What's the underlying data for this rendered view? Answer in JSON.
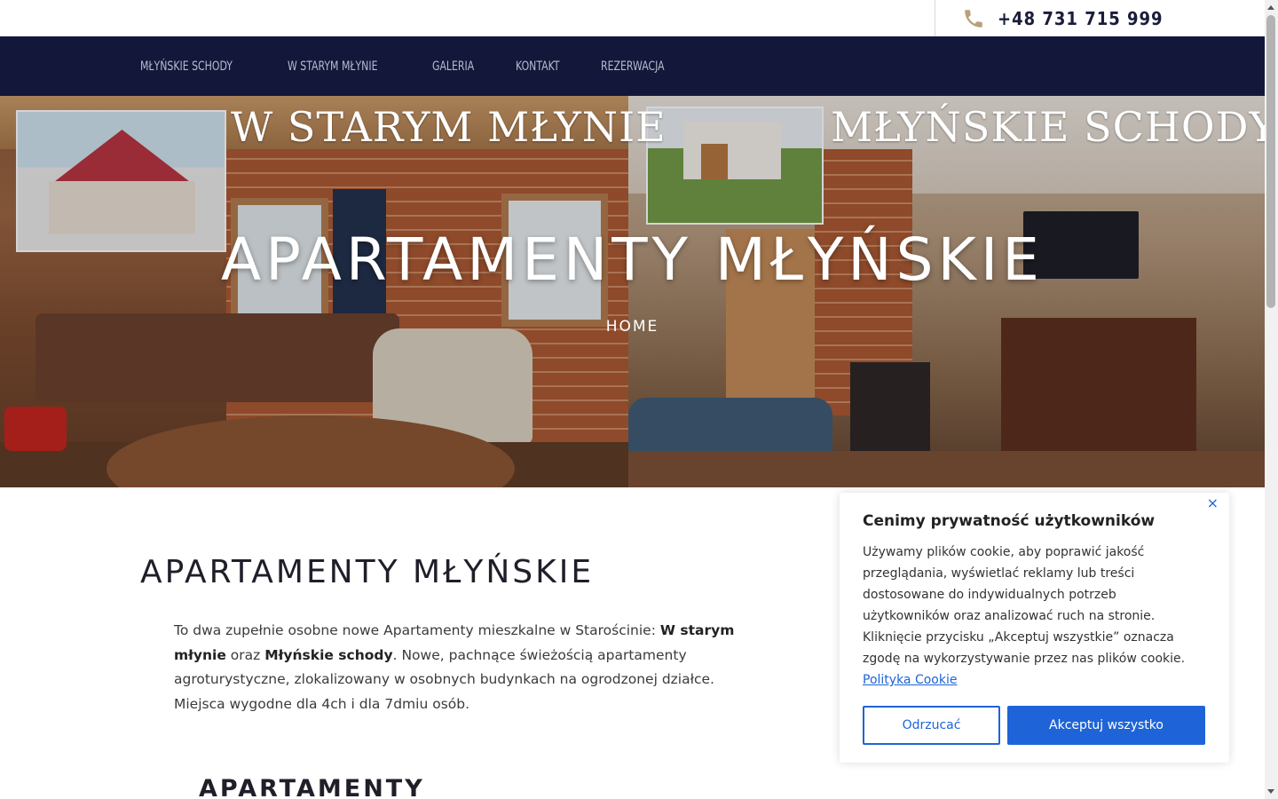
{
  "header": {
    "phone": "+48 731 715 999"
  },
  "nav": {
    "items": [
      {
        "label": "MŁYŃSKIE SCHODY"
      },
      {
        "label": "W STARYM MŁYNIE"
      },
      {
        "label": "GALERIA"
      },
      {
        "label": "KONTAKT"
      },
      {
        "label": "REZERWACJA"
      }
    ]
  },
  "hero": {
    "banner_left": "W STARYM MŁYNIE",
    "banner_right": "MŁYŃSKIE SCHODY",
    "title": "APARTAMENTY MŁYŃSKIE",
    "breadcrumb": "HOME"
  },
  "content": {
    "heading": "APARTAMENTY MŁYŃSKIE",
    "intro_1": "To dwa zupełnie osobne nowe Apartamenty mieszkalne w Starościnie: ",
    "intro_bold_1": "W starym młynie",
    "intro_2": " oraz ",
    "intro_bold_2": "Młyńskie schody",
    "intro_3": ". Nowe, pachnące świeżością apartamenty agroturystyczne, zlokalizowany w osobnych budynkach na ogrodzonej działce. Miejsca wygodne dla 4ch i dla 7dmiu osób.",
    "subheading": "APARTAMENTY"
  },
  "cookie": {
    "close": "×",
    "title": "Cenimy prywatność użytkowników",
    "body": "Używamy plików cookie, aby poprawić jakość przeglądania, wyświetlać reklamy lub treści dostosowane do indywidualnych potrzeb użytkowników oraz analizować ruch na stronie. Kliknięcie przycisku „Akceptuj wszystkie” oznacza zgodę na wykorzystywanie przez nas plików cookie.",
    "link": "Polityka Cookie",
    "reject": "Odrzucać",
    "accept": "Akceptuj wszystko"
  },
  "icons": {
    "phone": "phone-icon",
    "close": "close-icon"
  },
  "colors": {
    "nav_bg": "#13173a",
    "accent": "#1e64d8",
    "phone_icon": "#b8a07a"
  }
}
